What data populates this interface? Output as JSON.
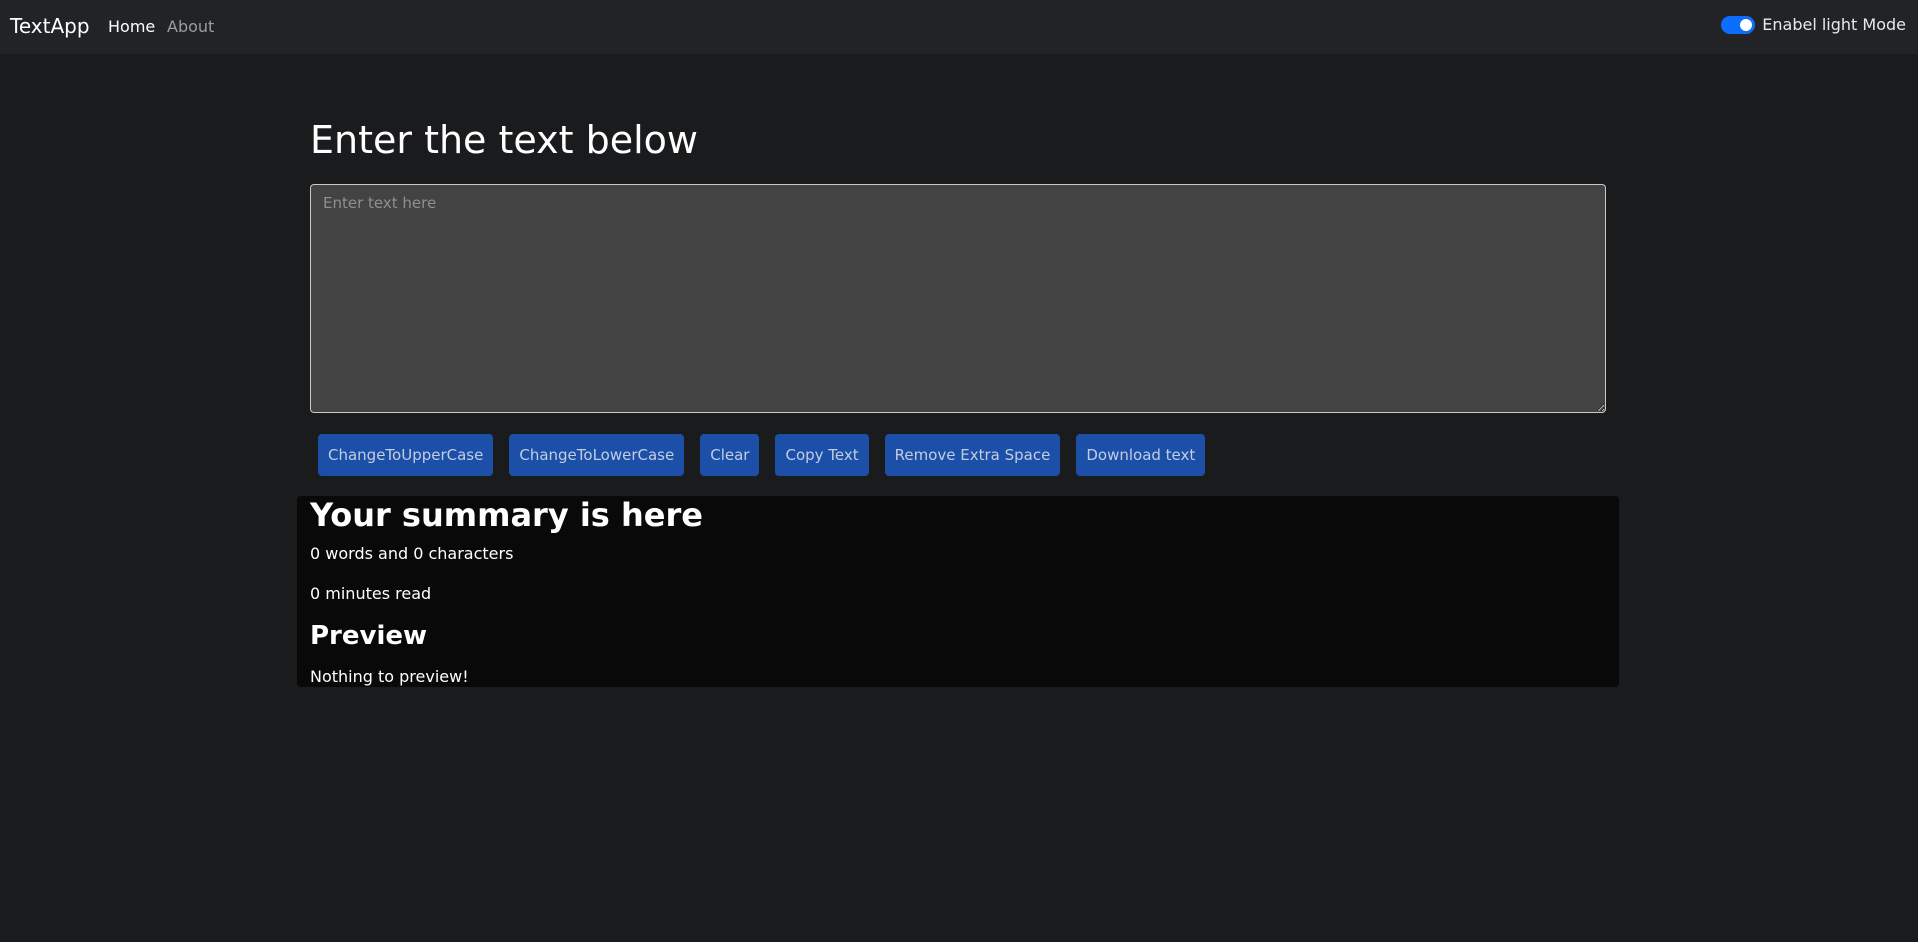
{
  "navbar": {
    "brand": "TextApp",
    "links": [
      {
        "label": "Home",
        "active": true
      },
      {
        "label": "About",
        "active": false
      }
    ],
    "mode_toggle": {
      "label": "Enabel light Mode",
      "checked": true
    }
  },
  "main": {
    "heading": "Enter the text below",
    "textarea": {
      "value": "",
      "placeholder": "Enter text here"
    },
    "buttons": [
      {
        "label": "ChangeToUpperCase"
      },
      {
        "label": "ChangeToLowerCase"
      },
      {
        "label": "Clear"
      },
      {
        "label": "Copy Text"
      },
      {
        "label": "Remove Extra Space"
      },
      {
        "label": "Download text"
      }
    ]
  },
  "summary": {
    "title": "Your summary is here",
    "words_chars": "0 words and 0 characters",
    "minutes_read": "0 minutes read",
    "preview_title": "Preview",
    "preview_text": "Nothing to preview!"
  },
  "colors": {
    "page_bg": "#1a1b1d",
    "navbar_bg": "#212326",
    "button_bg": "#1b4fa8",
    "toggle_accent": "#0d6efd",
    "summary_bg": "#090909",
    "textarea_bg": "#434343"
  }
}
